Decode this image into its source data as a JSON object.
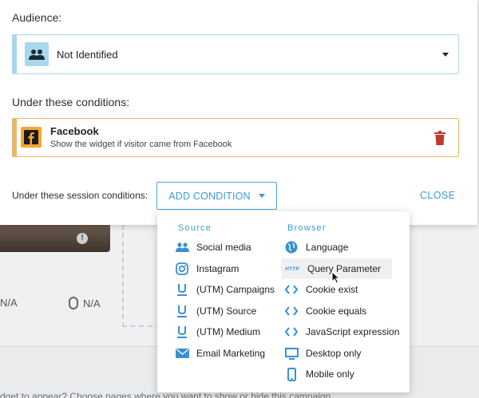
{
  "audience": {
    "label": "Audience:",
    "selected": "Not Identified"
  },
  "conditions": {
    "label": "Under these conditions:",
    "items": [
      {
        "title": "Facebook",
        "description": "Show the widget if visitor came from Facebook",
        "icon": "facebook-icon"
      }
    ]
  },
  "session": {
    "label": "Under these session conditions:",
    "add_button": "ADD CONDITION",
    "close_button": "CLOSE"
  },
  "dropdown": {
    "source_heading": "Source",
    "browser_heading": "Browser",
    "source_items": [
      {
        "label": "Social media",
        "icon": "users-icon"
      },
      {
        "label": "Instagram",
        "icon": "instagram-icon"
      },
      {
        "label": "(UTM) Campaigns",
        "icon": "utm-icon"
      },
      {
        "label": "(UTM) Source",
        "icon": "utm-icon"
      },
      {
        "label": "(UTM) Medium",
        "icon": "utm-icon"
      },
      {
        "label": "Email Marketing",
        "icon": "mail-icon"
      }
    ],
    "browser_items": [
      {
        "label": "Language",
        "icon": "globe-icon"
      },
      {
        "label": "Query Parameter",
        "icon": "http-icon",
        "icon_text": "HTTP"
      },
      {
        "label": "Cookie exist",
        "icon": "code-icon"
      },
      {
        "label": "Cookie equals",
        "icon": "code-icon"
      },
      {
        "label": "JavaScript expression",
        "icon": "code-icon"
      },
      {
        "label": "Desktop only",
        "icon": "desktop-icon"
      },
      {
        "label": "Mobile only",
        "icon": "mobile-icon"
      }
    ]
  },
  "background": {
    "na_left": "N/A",
    "na_right": "N/A",
    "bottom_text": "dget to appear? Choose pages where you want to show or hide this campaign."
  },
  "colors": {
    "accent": "#3a9bd6",
    "audience_border": "#a8d8ec",
    "condition_border": "#e8b86b",
    "facebook_tile": "#f7a82a",
    "trash": "#c0392b"
  }
}
